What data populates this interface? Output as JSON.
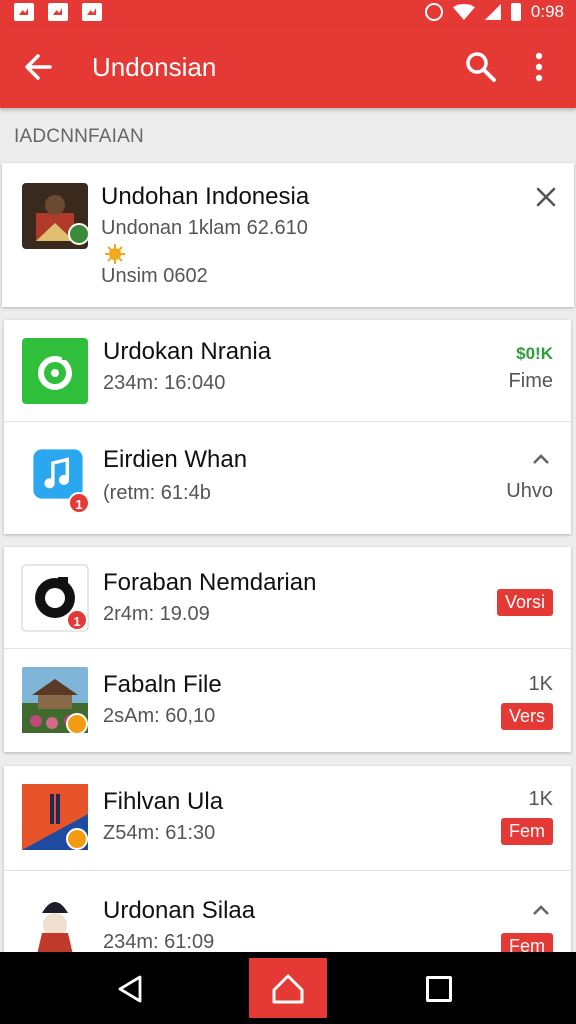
{
  "status_bar": {
    "time": "0:98",
    "icons": [
      "gallery-icon",
      "news-icon",
      "mail-icon",
      "alarm-icon",
      "wifi-icon",
      "signal-icon",
      "battery-icon"
    ]
  },
  "app_bar": {
    "title": "Undonsian",
    "back_icon": "arrow-left-icon",
    "search_icon": "search-icon",
    "more_icon": "more-vert-icon"
  },
  "section": {
    "header": "IADCNNFAIAN"
  },
  "featured": {
    "name": "Undohan Indonesia",
    "line1": "Undonan 1klam 62.610",
    "line2": "Unsim 0602",
    "icon": "indonesia-emblem-icon",
    "close_icon": "close-icon"
  },
  "groups": [
    {
      "items": [
        {
          "name": "Urdokan Nrania",
          "sub": "234m: 16:040",
          "right_top": "$0!K",
          "right_bottom": "Fime",
          "icon": "green-app-icon",
          "accent": "#2e9e3e"
        },
        {
          "name": "Eirdien Whan",
          "sub": "(retm: 61:4b",
          "right_bottom": "Uhvo",
          "icon": "music-app-icon",
          "badge": "1",
          "chevron": "chevron-up-icon"
        }
      ]
    },
    {
      "items": [
        {
          "name": "Foraban Nemdarian",
          "sub": "2r4m: 19.09",
          "pill": "Vorsi",
          "icon": "black-ring-app-icon",
          "badge": "1"
        },
        {
          "name": "Fabaln File",
          "sub": "2sAm: 60,10",
          "right_top": "1K",
          "pill": "Vers",
          "icon": "temple-photo-icon"
        }
      ]
    },
    {
      "items": [
        {
          "name": "Fihlvan Ula",
          "sub": "Z54m: 61:30",
          "right_top": "1K",
          "pill": "Fem",
          "icon": "flag-app-icon"
        },
        {
          "name": "Urdonan Silaa",
          "sub": "234m: 61:09",
          "pill": "Fem",
          "icon": "figure-app-icon",
          "chevron": "chevron-up-icon"
        }
      ]
    }
  ],
  "nav_bar": {
    "back": "nav-back-icon",
    "home": "nav-home-icon",
    "recent": "nav-recent-icon",
    "home_color": "#e53935"
  },
  "colors": {
    "primary": "#e53935",
    "background": "#ededed"
  }
}
